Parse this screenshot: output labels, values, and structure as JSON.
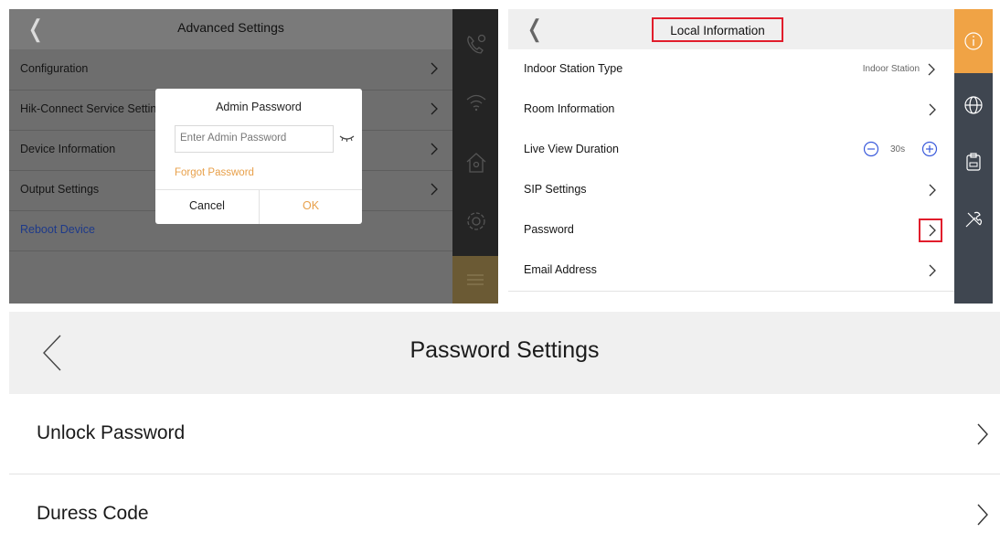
{
  "panel_advanced": {
    "title": "Advanced Settings",
    "rows": [
      {
        "label": "Configuration"
      },
      {
        "label": "Hik-Connect Service Setting"
      },
      {
        "label": "Device Information"
      },
      {
        "label": "Output Settings"
      },
      {
        "label": "Reboot Device"
      }
    ],
    "rail_icons": [
      "phone-settings-icon",
      "wifi-icon",
      "home-icon",
      "gear-icon",
      "sliders-icon"
    ],
    "modal": {
      "title": "Admin Password",
      "placeholder": "Enter Admin Password",
      "forgot": "Forgot Password",
      "cancel": "Cancel",
      "ok": "OK"
    },
    "colors": {
      "overlay": "#6e6e6e",
      "rail": "#242424",
      "accent": "#e8a04a",
      "reboot": "#1e3a8a"
    }
  },
  "panel_local": {
    "title": "Local Information",
    "rows": [
      {
        "label": "Indoor Station Type",
        "value": "Indoor Station"
      },
      {
        "label": "Room Information"
      },
      {
        "label": "Live View Duration",
        "value": "30s"
      },
      {
        "label": "SIP Settings"
      },
      {
        "label": "Password"
      },
      {
        "label": "Email Address"
      }
    ],
    "rail_icons": [
      "info-icon",
      "globe-icon",
      "clipboard-icon",
      "tools-icon"
    ],
    "colors": {
      "rail": "#3f4650",
      "active": "#f0a345",
      "highlight": "#e11d2c"
    }
  },
  "panel_password": {
    "title": "Password Settings",
    "rows": [
      {
        "label": "Unlock Password"
      },
      {
        "label": "Duress Code"
      }
    ]
  }
}
